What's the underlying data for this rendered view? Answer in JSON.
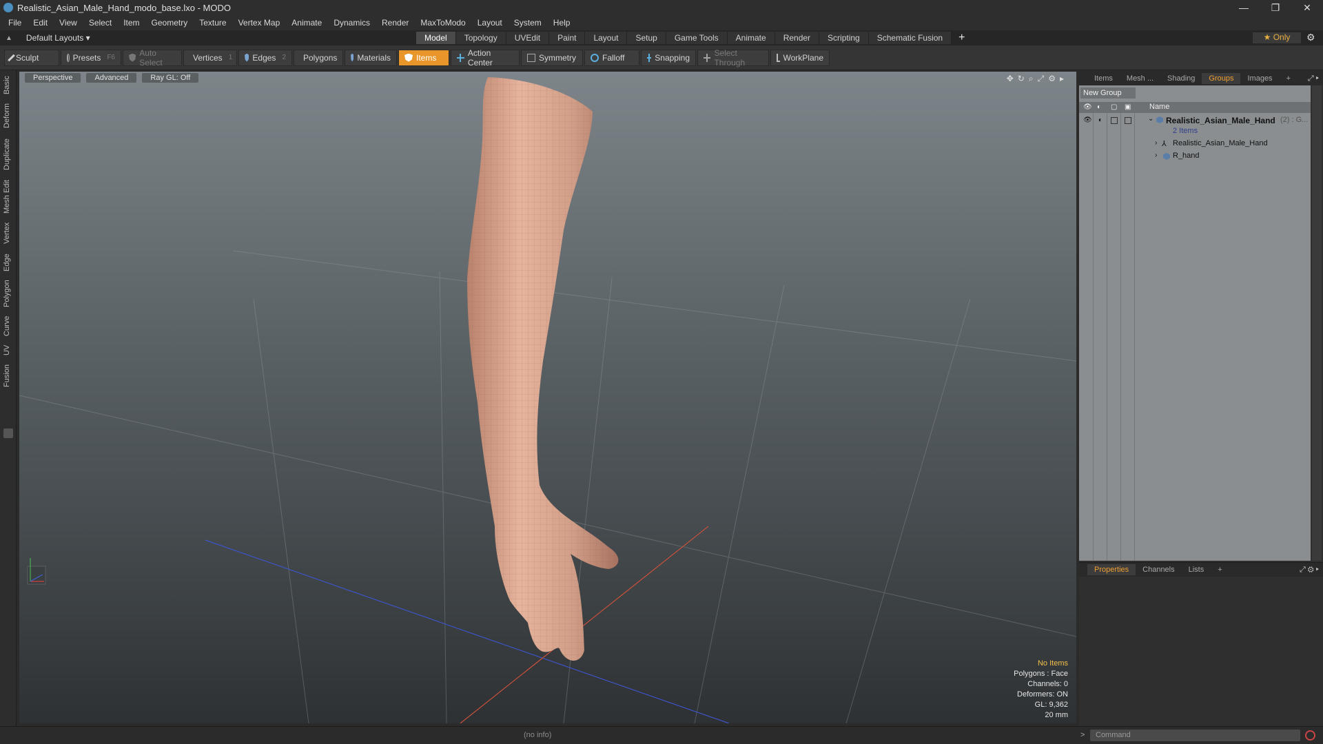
{
  "window": {
    "title": "Realistic_Asian_Male_Hand_modo_base.lxo - MODO",
    "controls": [
      "—",
      "❐",
      "✕"
    ]
  },
  "menu": [
    "File",
    "Edit",
    "View",
    "Select",
    "Item",
    "Geometry",
    "Texture",
    "Vertex Map",
    "Animate",
    "Dynamics",
    "Render",
    "MaxToModo",
    "Layout",
    "System",
    "Help"
  ],
  "layout_selector": "Default Layouts ▾",
  "tabs": [
    "Model",
    "Topology",
    "UVEdit",
    "Paint",
    "Layout",
    "Setup",
    "Game Tools",
    "Animate",
    "Render",
    "Scripting",
    "Schematic Fusion"
  ],
  "active_tab": "Model",
  "only_label": "★  Only",
  "toolbar": {
    "sculpt": "Sculpt",
    "presets": "Presets",
    "presets_key": "F6",
    "auto_select": "Auto Select",
    "vertices": "Vertices",
    "vertices_key": "1",
    "edges": "Edges",
    "edges_key": "2",
    "polygons": "Polygons",
    "materials": "Materials",
    "items": "Items",
    "action_center": "Action Center",
    "symmetry": "Symmetry",
    "falloff": "Falloff",
    "snapping": "Snapping",
    "select_through": "Select Through",
    "workplane": "WorkPlane"
  },
  "left_tabs": [
    "Basic",
    "Deform",
    "Duplicate",
    "Mesh Edit",
    "Vertex",
    "Edge",
    "Polygon",
    "Curve",
    "UV",
    "Fusion"
  ],
  "viewport": {
    "view": "Perspective",
    "shading": "Advanced",
    "raygl": "Ray GL: Off"
  },
  "info": {
    "items": "No Items",
    "polygons": "Polygons : Face",
    "channels": "Channels: 0",
    "deformers": "Deformers: ON",
    "gl": "GL: 9,362",
    "size": "20 mm"
  },
  "right_panel": {
    "tabs": [
      "Items",
      "Mesh ...",
      "Shading",
      "Groups",
      "Images",
      "+"
    ],
    "active_tab": "Groups",
    "new_group": "New Group",
    "name_header": "Name",
    "group_name": "Realistic_Asian_Male_Hand",
    "group_suffix": "(2) : G...",
    "group_count": "2 Items",
    "children": [
      "Realistic_Asian_Male_Hand",
      "R_hand"
    ]
  },
  "props_panel": {
    "tabs": [
      "Properties",
      "Channels",
      "Lists",
      "+"
    ],
    "active_tab": "Properties"
  },
  "status": {
    "no_info": "(no info)",
    "command_placeholder": "Command"
  }
}
